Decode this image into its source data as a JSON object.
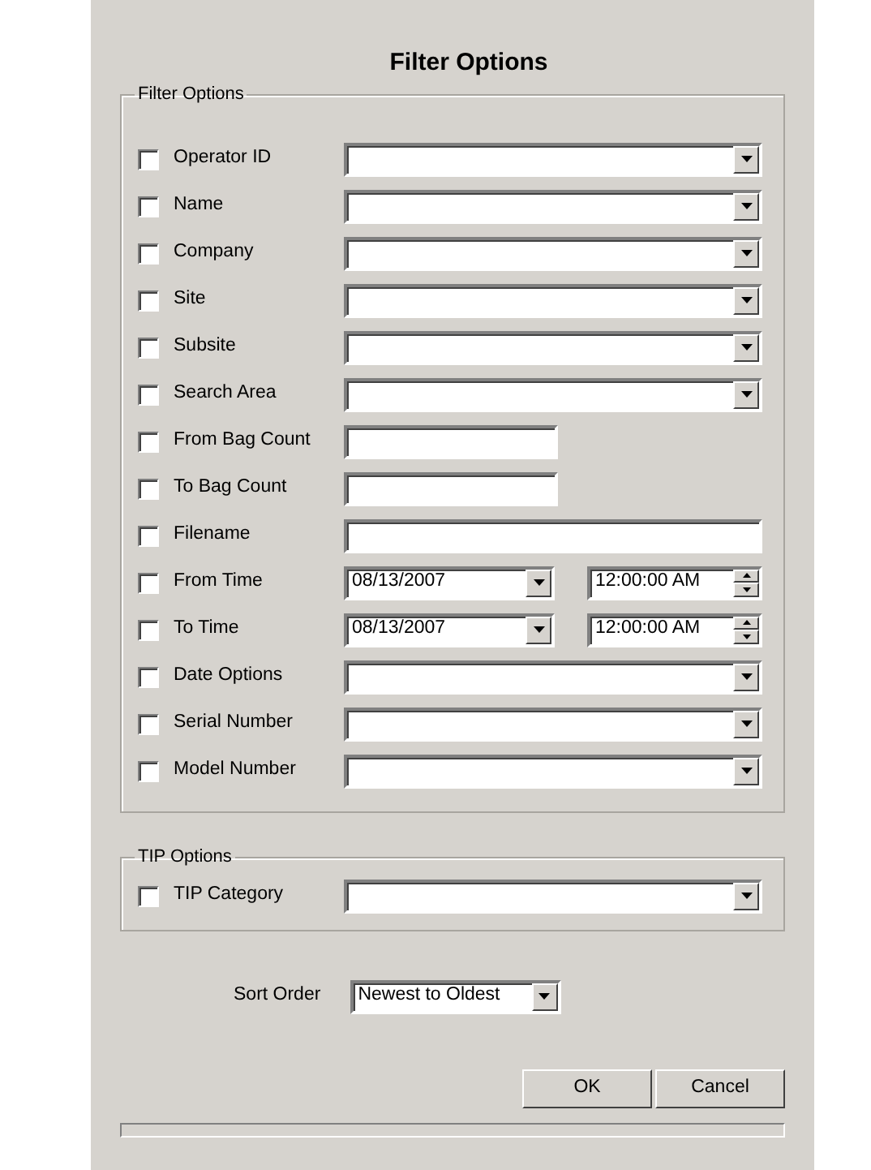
{
  "dialog": {
    "title": "Filter Options"
  },
  "filter_options": {
    "legend": "Filter Options",
    "rows": [
      {
        "label": "Operator ID",
        "checked": false,
        "kind": "combo"
      },
      {
        "label": "Name",
        "checked": false,
        "kind": "combo"
      },
      {
        "label": "Company",
        "checked": false,
        "kind": "combo"
      },
      {
        "label": "Site",
        "checked": false,
        "kind": "combo"
      },
      {
        "label": "Subsite",
        "checked": false,
        "kind": "combo"
      },
      {
        "label": "Search Area",
        "checked": false,
        "kind": "combo"
      },
      {
        "label": "From Bag Count",
        "checked": false,
        "kind": "short"
      },
      {
        "label": "To Bag Count",
        "checked": false,
        "kind": "short"
      },
      {
        "label": "Filename",
        "checked": false,
        "kind": "text"
      },
      {
        "label": "From Time",
        "checked": false,
        "kind": "datetime",
        "date": "08/13/2007",
        "time": "12:00:00 AM"
      },
      {
        "label": "To Time",
        "checked": false,
        "kind": "datetime",
        "date": "08/13/2007",
        "time": "12:00:00 AM"
      },
      {
        "label": "Date Options",
        "checked": false,
        "kind": "combo"
      },
      {
        "label": "Serial Number",
        "checked": false,
        "kind": "combo"
      },
      {
        "label": "Model Number",
        "checked": false,
        "kind": "combo"
      }
    ]
  },
  "tip_options": {
    "legend": "TIP Options",
    "rows": [
      {
        "label": "TIP Category",
        "checked": false,
        "kind": "combo"
      }
    ]
  },
  "sort_order": {
    "label": "Sort Order",
    "value": "Newest to Oldest"
  },
  "buttons": [
    {
      "label": "OK"
    },
    {
      "label": "Cancel"
    }
  ],
  "progress": {
    "level": 0
  }
}
